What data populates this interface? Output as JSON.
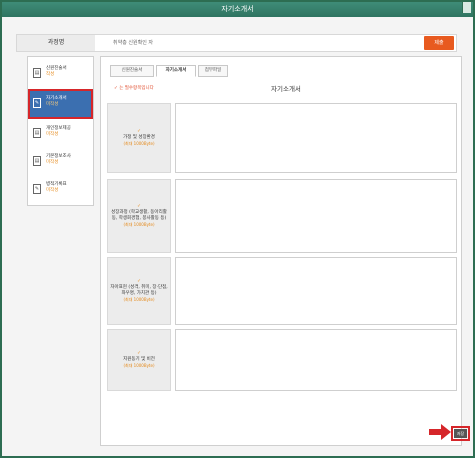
{
  "window": {
    "title": "자기소개서"
  },
  "header": {
    "name_label": "과정명",
    "name_value": "취약층 신원확인 자",
    "submit_label": "제출"
  },
  "sidebar": {
    "items": [
      {
        "label": "신원진술서",
        "status": "작성",
        "icon": "document-icon"
      },
      {
        "label": "자기소개서",
        "status": "미작성",
        "icon": "edit-icon"
      },
      {
        "label": "개인정보제공",
        "status": "미작성",
        "icon": "document-icon"
      },
      {
        "label": "기본정보조사",
        "status": "미작성",
        "icon": "document-icon"
      },
      {
        "label": "병적기록표",
        "status": "미작성",
        "icon": "edit-icon"
      }
    ]
  },
  "main": {
    "tabs": [
      {
        "label": "신원진술서"
      },
      {
        "label": "자기소개서"
      },
      {
        "label": "첨부파일"
      }
    ],
    "required_note": "✓ 는 필수항목입니다",
    "heading": "자기소개서",
    "questions": [
      {
        "text": "가정 및 성장환경",
        "limit": "(최대 1000Byte)"
      },
      {
        "text": "성장과정 (학교생활, 동아리활동, 학생회경험, 봉사활동 등)",
        "limit": "(최대 1000Byte)"
      },
      {
        "text": "자아표현 (성격, 취미, 장·단점, 좌우명, 가치관 등)",
        "limit": "(최대 1000Byte)"
      },
      {
        "text": "지원동기 및 비전",
        "limit": "(최대 1000Byte)"
      }
    ],
    "save_label": "저장"
  },
  "colors": {
    "titlebar": "#3f8c78",
    "submit": "#e85a1f",
    "active_sidebar": "#3b6fb0",
    "highlight": "#d6262a",
    "status": "#e58a1c"
  }
}
